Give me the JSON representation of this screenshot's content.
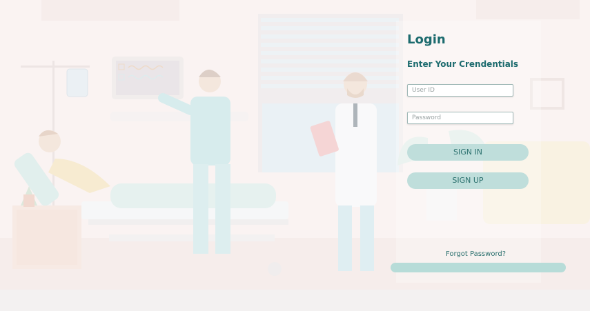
{
  "login": {
    "title": "Login",
    "subtitle": "Enter Your Crendentials",
    "userid_placeholder": "User ID",
    "password_placeholder": "Password",
    "signin_label": "SIGN IN",
    "signup_label": "SIGN UP",
    "forgot_label": "Forgot Password?"
  },
  "colors": {
    "accent": "#1c6b6e",
    "button_bg": "#bfdedb",
    "button_text": "#2a6f6d"
  },
  "illustration": {
    "subject": "hospital-room-illustration"
  }
}
